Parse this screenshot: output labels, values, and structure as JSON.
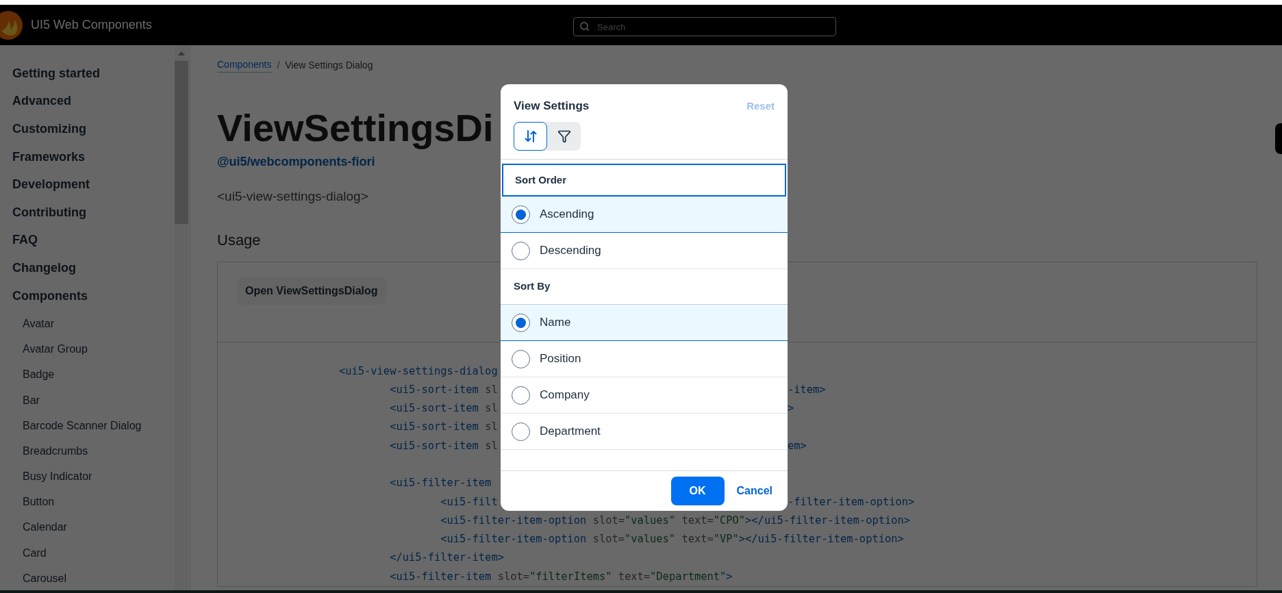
{
  "header": {
    "title": "UI5 Web Components",
    "search": {
      "placeholder": "Search"
    }
  },
  "sidebar": {
    "sections": [
      {
        "label": "Getting started"
      },
      {
        "label": "Advanced"
      },
      {
        "label": "Customizing"
      },
      {
        "label": "Frameworks"
      },
      {
        "label": "Development"
      },
      {
        "label": "Contributing"
      },
      {
        "label": "FAQ"
      },
      {
        "label": "Changelog"
      },
      {
        "label": "Components"
      }
    ],
    "components": [
      {
        "label": "Avatar"
      },
      {
        "label": "Avatar Group"
      },
      {
        "label": "Badge"
      },
      {
        "label": "Bar"
      },
      {
        "label": "Barcode Scanner Dialog"
      },
      {
        "label": "Breadcrumbs"
      },
      {
        "label": "Busy Indicator"
      },
      {
        "label": "Button"
      },
      {
        "label": "Calendar"
      },
      {
        "label": "Card"
      },
      {
        "label": "Carousel"
      }
    ]
  },
  "breadcrumbs": [
    {
      "label": "Components",
      "kind": "link"
    },
    {
      "label": "View Settings Dialog",
      "kind": "current"
    }
  ],
  "breadcrumb_separator": "/",
  "page_title": "ViewSettingsDi",
  "package": "@ui5/webcomponents-fiori",
  "tag_name": "<ui5-view-settings-dialog>",
  "usage_heading": "Usage",
  "sample_button": "Open ViewSettingsDialog",
  "code_lines": [
    {
      "left": [
        {
          "kind": "tag",
          "text": "<ui5-view-settings-dialog"
        }
      ]
    },
    {
      "left": [
        {
          "kind": "tag",
          "text": "        <ui5-sort-item"
        },
        {
          "kind": "attr",
          "text": " sl"
        }
      ],
      "right": [
        {
          "kind": "tag",
          "text": "-item>"
        }
      ]
    },
    {
      "left": [
        {
          "kind": "tag",
          "text": "        <ui5-sort-item"
        },
        {
          "kind": "attr",
          "text": " sl"
        }
      ],
      "right": [
        {
          "kind": "tag",
          "text": ">"
        }
      ]
    },
    {
      "left": [
        {
          "kind": "tag",
          "text": "        <ui5-sort-item"
        },
        {
          "kind": "attr",
          "text": " sl"
        }
      ]
    },
    {
      "left": [
        {
          "kind": "tag",
          "text": "        <ui5-sort-item"
        },
        {
          "kind": "attr",
          "text": " sl"
        }
      ],
      "right": [
        {
          "kind": "tag",
          "text": "em>"
        }
      ]
    },
    {
      "blank_before": true,
      "left": [
        {
          "kind": "tag",
          "text": "        <ui5-filter-item"
        }
      ]
    },
    {
      "left": [
        {
          "kind": "tag",
          "text": "                <ui5-filt"
        }
      ],
      "right": [
        {
          "kind": "tag",
          "text": "-filter-item-option>"
        }
      ]
    },
    {
      "left": [
        {
          "kind": "tag",
          "text": "                <ui5-filter-item-option"
        },
        {
          "kind": "attr",
          "text": " slot="
        },
        {
          "kind": "value",
          "text": "\"values\""
        },
        {
          "kind": "attr",
          "text": " text="
        },
        {
          "kind": "value",
          "text": "\"CPO\""
        },
        {
          "kind": "tag",
          "text": "></ui5-filter-item-option>"
        }
      ]
    },
    {
      "left": [
        {
          "kind": "tag",
          "text": "                <ui5-filter-item-option"
        },
        {
          "kind": "attr",
          "text": " slot="
        },
        {
          "kind": "value",
          "text": "\"values\""
        },
        {
          "kind": "attr",
          "text": " text="
        },
        {
          "kind": "value",
          "text": "\"VP\""
        },
        {
          "kind": "tag",
          "text": "></ui5-filter-item-option>"
        }
      ]
    },
    {
      "left": [
        {
          "kind": "tag",
          "text": "        </ui5-filter-item>"
        }
      ]
    },
    {
      "left": [
        {
          "kind": "tag",
          "text": "        <ui5-filter-item"
        },
        {
          "kind": "attr",
          "text": " slot="
        },
        {
          "kind": "value",
          "text": "\"filterItems\""
        },
        {
          "kind": "attr",
          "text": " text="
        },
        {
          "kind": "value",
          "text": "\"Department\""
        },
        {
          "kind": "tag",
          "text": ">"
        }
      ]
    }
  ],
  "dialog": {
    "title": "View Settings",
    "reset": {
      "label": "Reset",
      "disabled": true
    },
    "modes": [
      {
        "kind": "sort",
        "selected": true
      },
      {
        "kind": "filter",
        "selected": false
      }
    ],
    "groups": [
      {
        "heading": "Sort Order",
        "focused": true,
        "options": [
          {
            "label": "Ascending",
            "selected": true
          },
          {
            "label": "Descending",
            "selected": false
          }
        ]
      },
      {
        "heading": "Sort By",
        "focused": false,
        "options": [
          {
            "label": "Name",
            "selected": true
          },
          {
            "label": "Position",
            "selected": false
          },
          {
            "label": "Company",
            "selected": false
          },
          {
            "label": "Department",
            "selected": false
          }
        ]
      }
    ],
    "ok": "OK",
    "cancel": "Cancel"
  }
}
